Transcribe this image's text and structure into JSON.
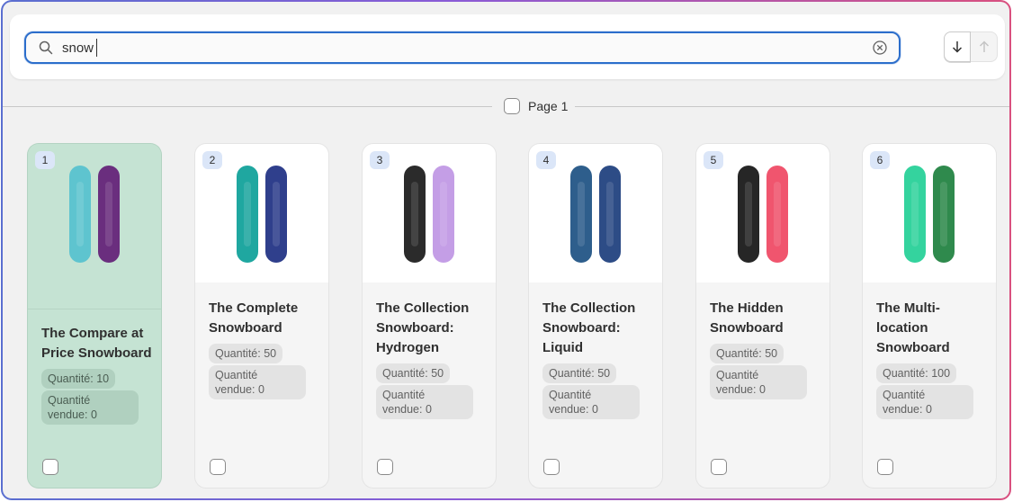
{
  "search": {
    "value": "snow",
    "placeholder": ""
  },
  "sort": {
    "down_icon": "arrow-down-icon",
    "up_icon": "arrow-up-icon"
  },
  "page_divider": {
    "label": "Page 1"
  },
  "products": [
    {
      "index": "1",
      "title": "The Compare at Price Snowboard",
      "quantity": "Quantité: 10",
      "sold": "Quantité vendue: 0",
      "selected": true,
      "colors": [
        "#5ec4cf",
        "#6a2e7e"
      ]
    },
    {
      "index": "2",
      "title": "The Complete Snowboard",
      "quantity": "Quantité: 50",
      "sold": "Quantité vendue: 0",
      "selected": false,
      "colors": [
        "#1fa7a0",
        "#2f3f8c"
      ]
    },
    {
      "index": "3",
      "title": "The Collection Snowboard: Hydrogen",
      "quantity": "Quantité: 50",
      "sold": "Quantité vendue: 0",
      "selected": false,
      "colors": [
        "#2b2b2b",
        "#c49ee6"
      ]
    },
    {
      "index": "4",
      "title": "The Collection Snowboard: Liquid",
      "quantity": "Quantité: 50",
      "sold": "Quantité vendue: 0",
      "selected": false,
      "colors": [
        "#2e5e8c",
        "#2d4c86"
      ]
    },
    {
      "index": "5",
      "title": "The Hidden Snowboard",
      "quantity": "Quantité: 50",
      "sold": "Quantité vendue: 0",
      "selected": false,
      "colors": [
        "#262626",
        "#f0556e"
      ]
    },
    {
      "index": "6",
      "title": "The Multi-location Snowboard",
      "quantity": "Quantité: 100",
      "sold": "Quantité vendue: 0",
      "selected": false,
      "colors": [
        "#34d39e",
        "#2f8a4d"
      ]
    }
  ]
}
